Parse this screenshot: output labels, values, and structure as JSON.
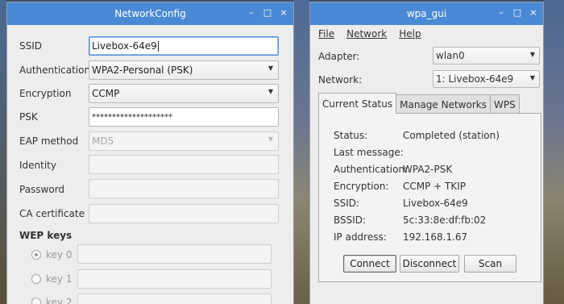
{
  "network_config": {
    "title": "NetworkConfig",
    "fields": {
      "ssid": {
        "label": "SSID",
        "value": "Livebox-64e9"
      },
      "authentication": {
        "label": "Authentication",
        "value": "WPA2-Personal (PSK)"
      },
      "encryption": {
        "label": "Encryption",
        "value": "CCMP"
      },
      "psk": {
        "label": "PSK",
        "value": "********************"
      },
      "eap_method": {
        "label": "EAP method",
        "value": "MD5"
      },
      "identity": {
        "label": "Identity",
        "value": ""
      },
      "password": {
        "label": "Password",
        "value": ""
      },
      "ca_certificate": {
        "label": "CA certificate",
        "value": ""
      }
    },
    "wep_keys": {
      "title": "WEP keys",
      "keys": [
        "key 0",
        "key 1",
        "key 2"
      ]
    }
  },
  "wpa_gui": {
    "title": "wpa_gui",
    "menu": [
      "File",
      "Network",
      "Help"
    ],
    "adapter": {
      "label": "Adapter:",
      "value": "wlan0"
    },
    "network": {
      "label": "Network:",
      "value": "1: Livebox-64e9"
    },
    "tabs": [
      "Current Status",
      "Manage Networks",
      "WPS"
    ],
    "status": {
      "status": {
        "label": "Status:",
        "value": "Completed (station)"
      },
      "last_message": {
        "label": "Last message:",
        "value": ""
      },
      "authentication": {
        "label": "Authentication:",
        "value": "WPA2-PSK"
      },
      "encryption": {
        "label": "Encryption:",
        "value": "CCMP + TKIP"
      },
      "ssid": {
        "label": "SSID:",
        "value": "Livebox-64e9"
      },
      "bssid": {
        "label": "BSSID:",
        "value": "5c:33:8e:df:fb:02"
      },
      "ip_address": {
        "label": "IP address:",
        "value": "192.168.1.67"
      }
    },
    "buttons": {
      "connect": "Connect",
      "disconnect": "Disconnect",
      "scan": "Scan"
    }
  },
  "window_controls": {
    "minimize": "–",
    "maximize": "□",
    "close": "×"
  },
  "colors": {
    "titlebar": "#4a8ad4",
    "window_bg": "#ededed",
    "focus": "#5b8ed8"
  }
}
